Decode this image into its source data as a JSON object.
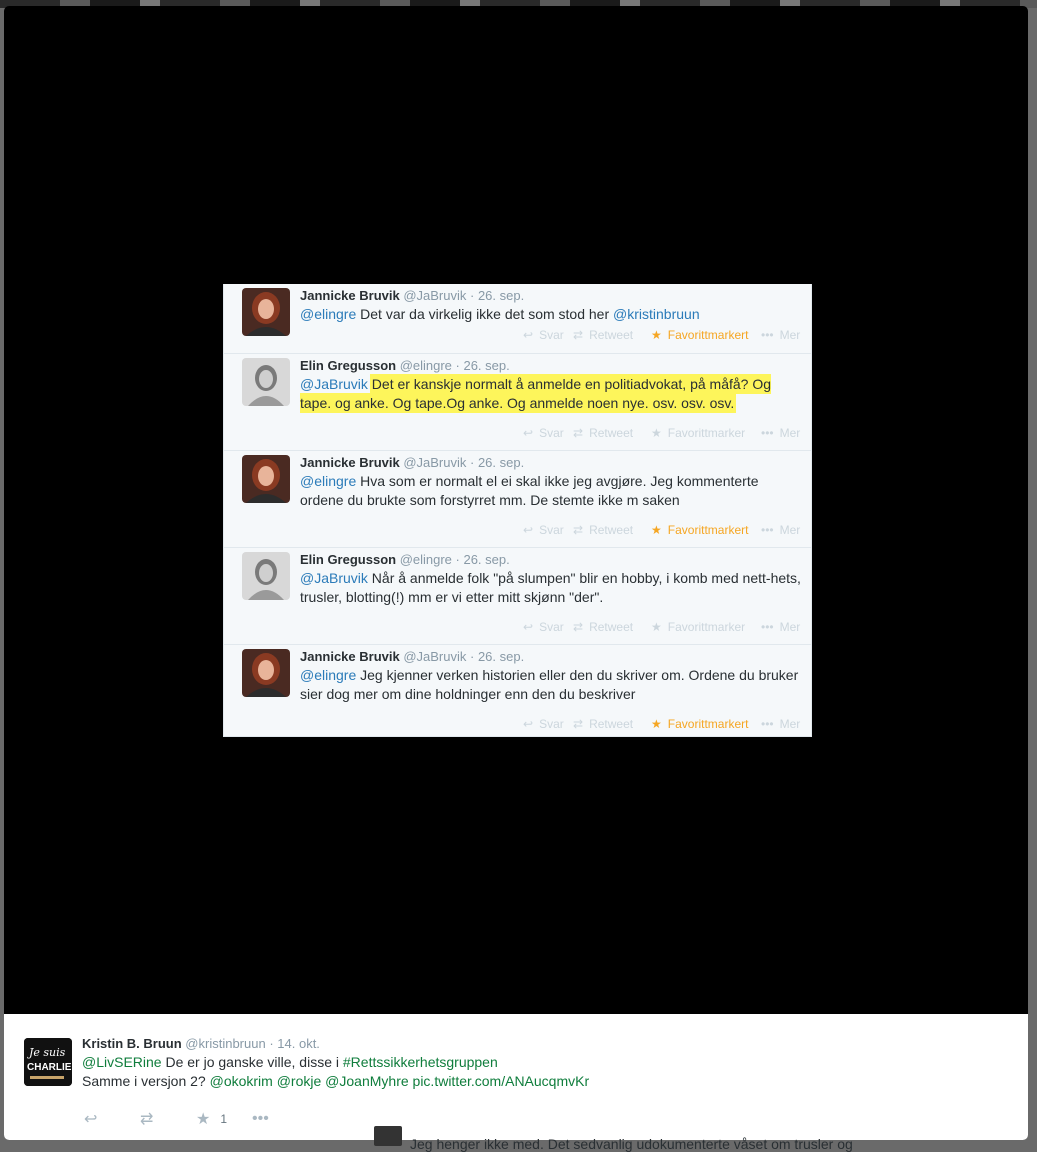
{
  "media_tweets": [
    {
      "name": "Jannicke Bruvik",
      "handle": "@JaBruvik",
      "time": "26. sep.",
      "avatar": "woman-red-hair",
      "segments": [
        {
          "text": "@elingre",
          "mention": true
        },
        {
          "text": " Det var da virkelig ikke det som stod her "
        },
        {
          "text": "@kristinbruun",
          "mention": true
        }
      ],
      "favorited": true
    },
    {
      "name": "Elin Gregusson",
      "handle": "@elingre",
      "time": "26. sep.",
      "avatar": "woman-bw",
      "segments": [
        {
          "text": "@JaBruvik",
          "mention": true
        },
        {
          "text": " "
        },
        {
          "text": "Det er kanskje normalt å anmelde en politiadvokat, på måfå? Og tape. og anke. Og tape.Og anke. Og anmelde noen nye. osv. osv. osv.",
          "highlight": true
        }
      ],
      "favorited": false
    },
    {
      "name": "Jannicke Bruvik",
      "handle": "@JaBruvik",
      "time": "26. sep.",
      "avatar": "woman-red-hair",
      "segments": [
        {
          "text": "@elingre",
          "mention": true
        },
        {
          "text": " Hva som er normalt el ei skal ikke jeg avgjøre. Jeg kommenterte ordene du brukte som forstyrret mm. De stemte ikke m saken"
        }
      ],
      "favorited": true
    },
    {
      "name": "Elin Gregusson",
      "handle": "@elingre",
      "time": "26. sep.",
      "avatar": "woman-bw",
      "segments": [
        {
          "text": "@JaBruvik",
          "mention": true
        },
        {
          "text": " Når å anmelde folk \"på slumpen\" blir en hobby, i komb med nett-hets, trusler, blotting(!) mm er vi etter mitt skjønn \"der\"."
        }
      ],
      "favorited": false
    },
    {
      "name": "Jannicke Bruvik",
      "handle": "@JaBruvik",
      "time": "26. sep.",
      "avatar": "woman-red-hair",
      "segments": [
        {
          "text": "@elingre",
          "mention": true
        },
        {
          "text": " Jeg kjenner verken historien eller den du skriver om. Ordene du bruker sier dog mer om dine holdninger enn den du beskriver"
        }
      ],
      "favorited": true
    }
  ],
  "action_labels": {
    "reply": "Svar",
    "retweet": "Retweet",
    "favorite": "Favorittmarker",
    "favorited": "Favorittmarkert",
    "more": "Mer"
  },
  "footer_tweet": {
    "name": "Kristin B. Bruun",
    "handle": "@kristinbruun",
    "time": "14. okt.",
    "avatar_text_1": "Je suis",
    "avatar_text_2": "CHARLIE",
    "line1": [
      {
        "text": "@LivSERine",
        "mention": true
      },
      {
        "text": " De er jo ganske ville, disse i "
      },
      {
        "text": "#Rettssikkerhetsgruppen",
        "mention": true
      }
    ],
    "line2": [
      {
        "text": "Samme i versjon 2? "
      },
      {
        "text": "@okokrim",
        "mention": true
      },
      {
        "text": " "
      },
      {
        "text": "@rokje",
        "mention": true
      },
      {
        "text": " "
      },
      {
        "text": "@JoanMyhre",
        "mention": true
      },
      {
        "text": " "
      },
      {
        "text": "pic.twitter.com/ANAucqmvKr",
        "mention": true
      }
    ],
    "favorite_count": "1"
  },
  "underlying_text": "Jeg henger ikke med. Det sedvanlig udokumenterte våset om trusler og"
}
